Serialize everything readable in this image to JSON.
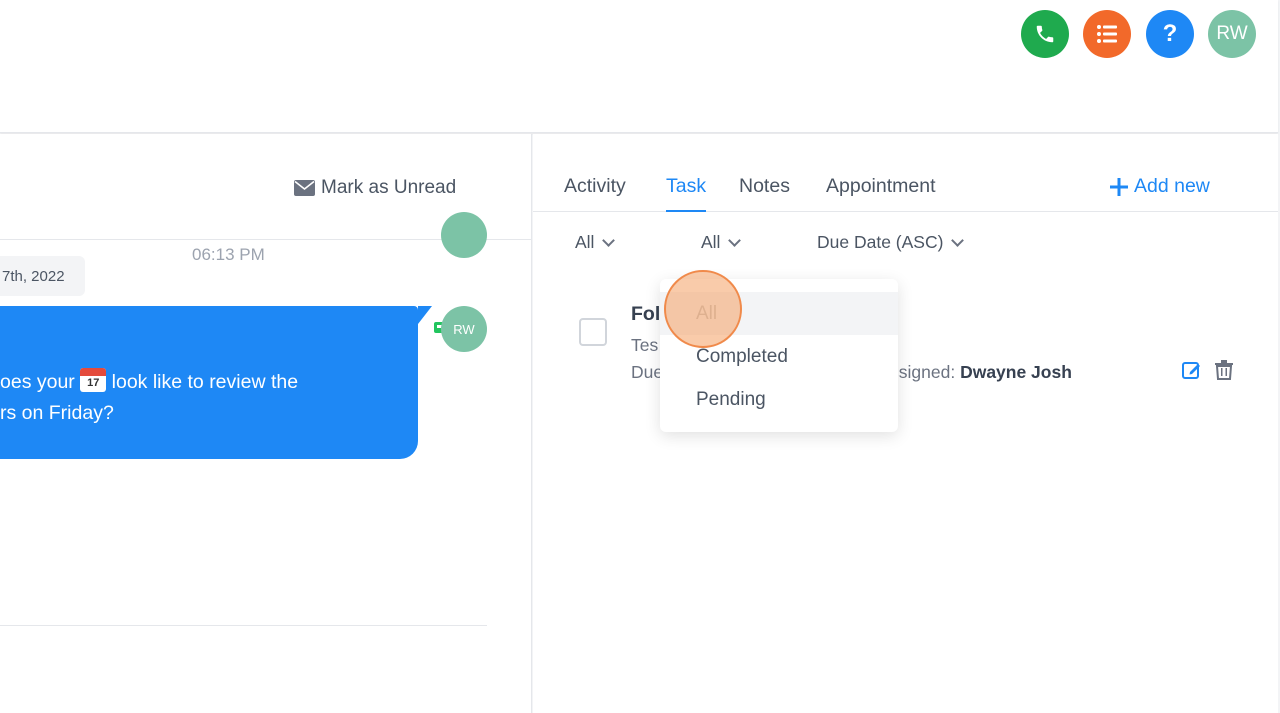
{
  "topbar": {
    "avatar_initials": "RW",
    "help_symbol": "?"
  },
  "conversation": {
    "mark_unread_label": "Mark as Unread",
    "message_time": "06:13 PM",
    "date_chip": "7th, 2022",
    "message_line1_before": "oes your",
    "calendar_day": "17",
    "message_line1_after": "look like to review the",
    "message_line2": "rs on Friday?",
    "sender_initials": "RW"
  },
  "tabs": [
    {
      "label": "Activity"
    },
    {
      "label": "Task"
    },
    {
      "label": "Notes"
    },
    {
      "label": "Appointment"
    }
  ],
  "active_tab": "Task",
  "add_new_label": "Add new",
  "filters": {
    "filter1": "All",
    "filter2": "All",
    "sort": "Due Date (ASC)"
  },
  "task": {
    "title_partial": "Fol",
    "subtitle_partial": "Tes",
    "due_partial": "Due",
    "assigned_label": "ssigned:",
    "assigned_name": "Dwayne Josh"
  },
  "dropdown": {
    "options": [
      "All",
      "Completed",
      "Pending"
    ],
    "selected": "All"
  },
  "colors": {
    "accent": "#1e88f5",
    "phone": "#1faa4e",
    "list": "#f2692a",
    "avatar": "#7cc3a6"
  }
}
